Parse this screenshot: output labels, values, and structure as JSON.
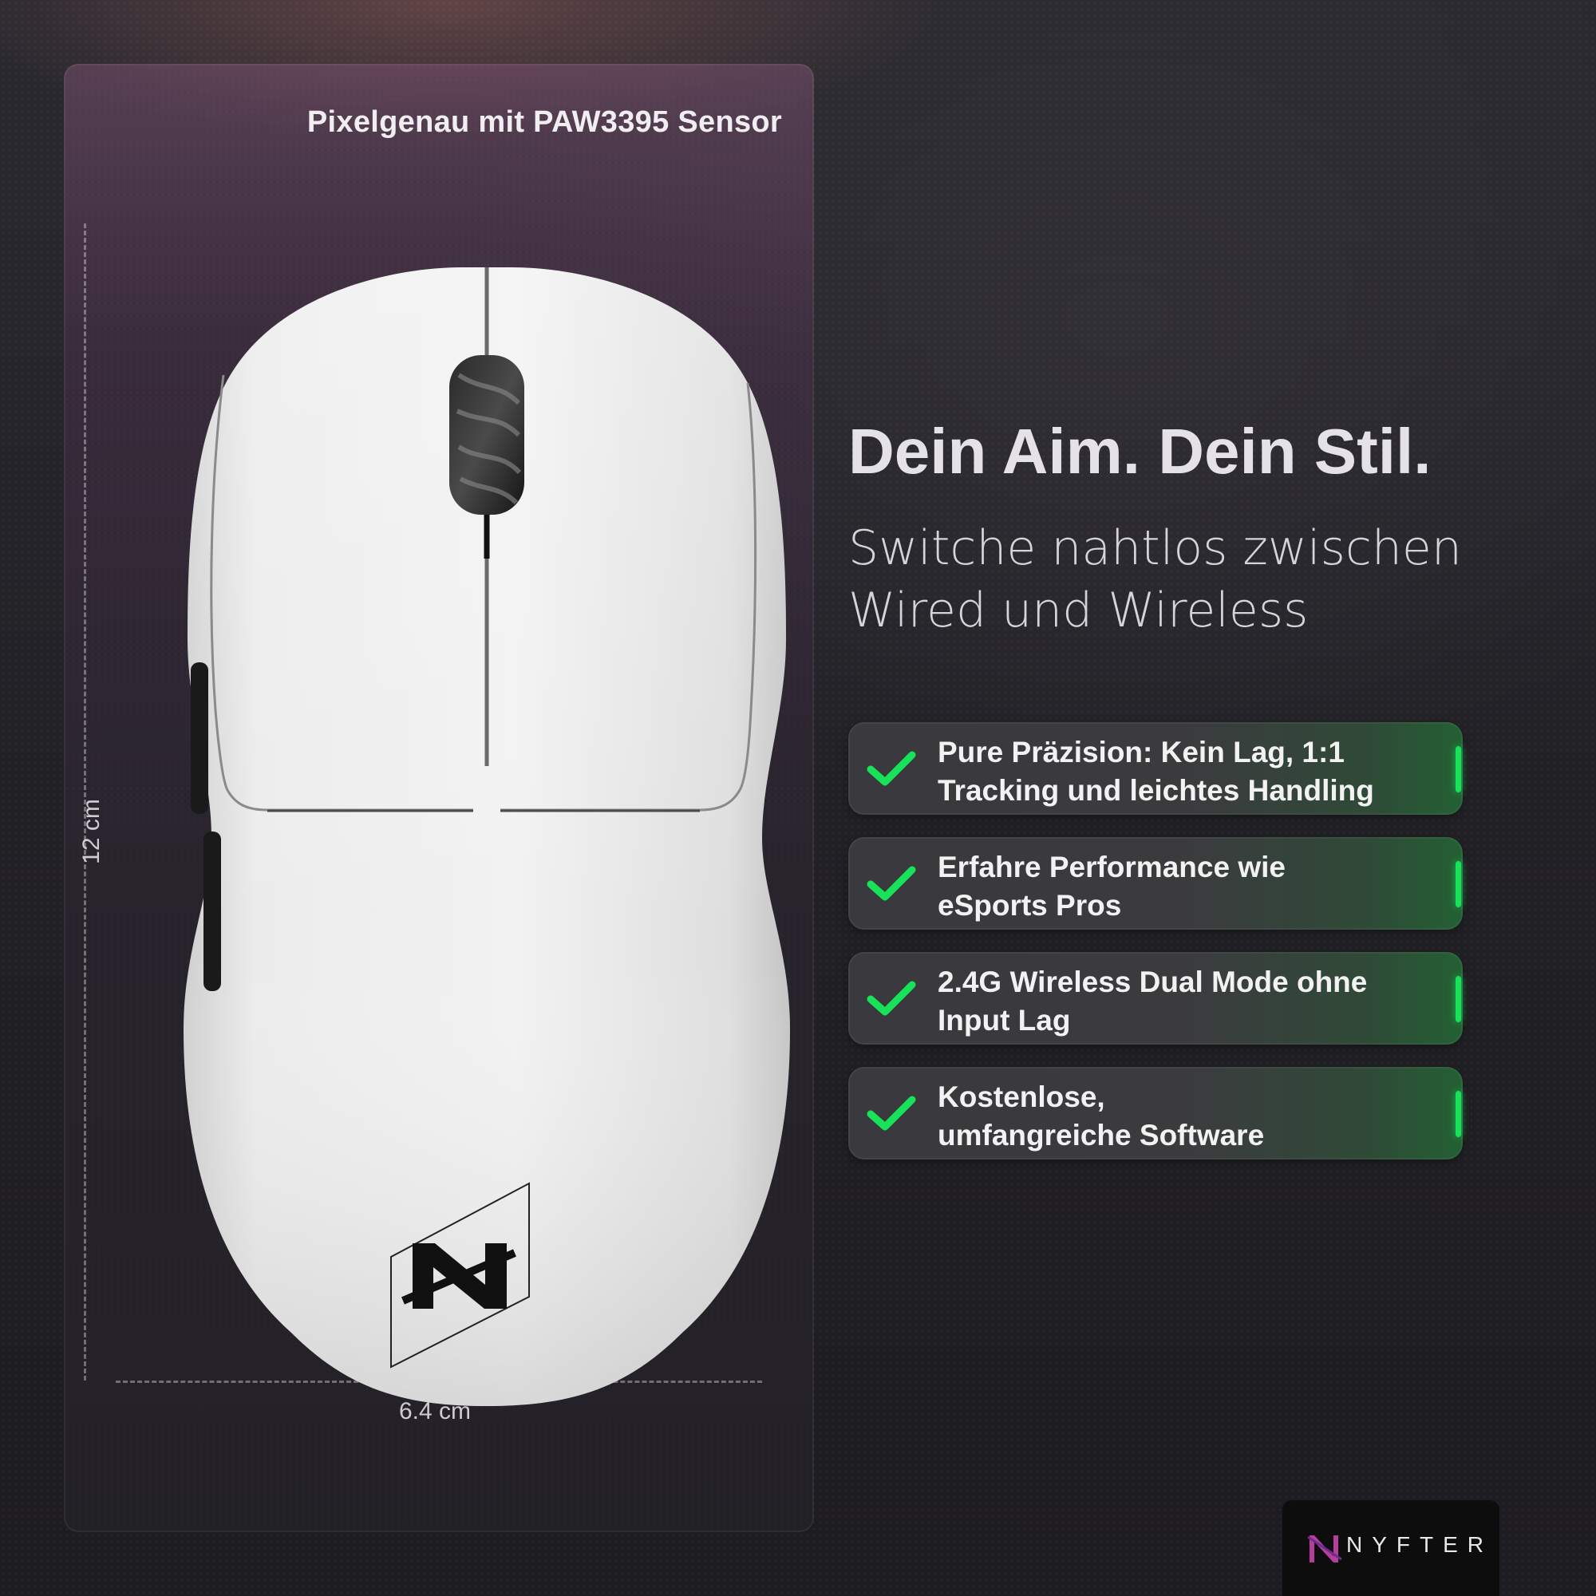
{
  "panel": {
    "title": "Pixelgenau mit PAW3395 Sensor",
    "height_label": "12 cm",
    "width_label": "6.4 cm"
  },
  "heading": "Dein Aim. Dein Stil.",
  "subheading_lines": [
    "Switche nahtlos zwischen",
    "Wired und Wireless"
  ],
  "features": [
    {
      "line1": "Pure Präzision: Kein Lag, 1:1",
      "line2": "Tracking und leichtes Handling"
    },
    {
      "line1": "Erfahre Performance wie",
      "line2": "eSports Pros"
    },
    {
      "line1": "2.4G Wireless Dual Mode ohne",
      "line2": "Input Lag"
    },
    {
      "line1": "Kostenlose,",
      "line2": "umfangreiche Software"
    }
  ],
  "brand": {
    "name": "NYFTER"
  },
  "colors": {
    "accent": "#18e25a",
    "background": "#1f1e22"
  },
  "icons": {
    "feature_check": "check-icon",
    "logo": "nyfter-logo-icon",
    "product": "mouse-image"
  }
}
